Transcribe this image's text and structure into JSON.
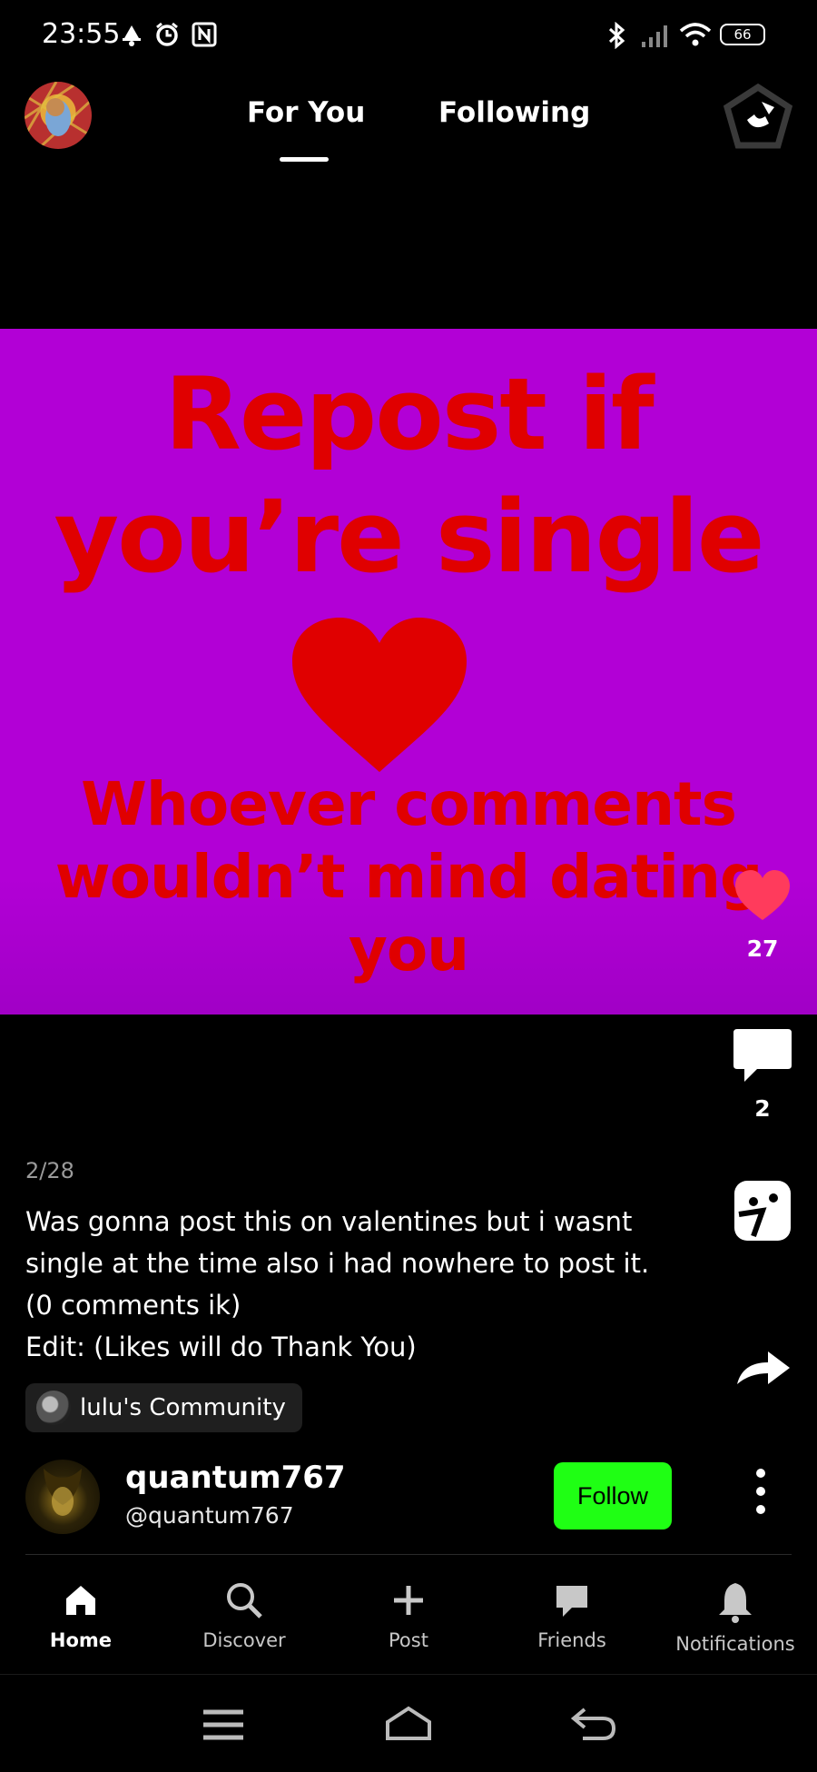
{
  "status_bar": {
    "time": "23:55",
    "battery": "66",
    "icons": [
      "notification-icon",
      "alarm-icon",
      "nfc-icon",
      "bluetooth-icon",
      "signal-icon",
      "wifi-icon",
      "battery-icon"
    ]
  },
  "top_nav": {
    "tabs": [
      {
        "label": "For You",
        "active": true
      },
      {
        "label": "Following",
        "active": false
      }
    ]
  },
  "post_image": {
    "line1": "Repost if",
    "line2": "you’re single",
    "line3": "Whoever comments",
    "line4": "wouldn’t mind dating",
    "line5": "you",
    "background_color": "#b200d6",
    "text_color": "#e00000"
  },
  "actions": {
    "likes": "27",
    "comments": "2",
    "like_color": "#ff3b5c"
  },
  "post": {
    "date": "2/28",
    "caption_lines": [
      "Was gonna post this on valentines but i wasnt",
      "single at the time also i had nowhere to post it.",
      "(0 comments ik)",
      "Edit: (Likes will do Thank You)"
    ],
    "community": "lulu's Community"
  },
  "author": {
    "name": "quantum767",
    "handle": "@quantum767",
    "follow_label": "Follow",
    "follow_color": "#1fff14"
  },
  "bottom_nav": {
    "items": [
      {
        "label": "Home",
        "icon": "home-icon",
        "active": true
      },
      {
        "label": "Discover",
        "icon": "search-icon",
        "active": false
      },
      {
        "label": "Post",
        "icon": "plus-icon",
        "active": false
      },
      {
        "label": "Friends",
        "icon": "chat-icon",
        "active": false
      },
      {
        "label": "Notifications",
        "icon": "bell-icon",
        "active": false
      }
    ]
  }
}
